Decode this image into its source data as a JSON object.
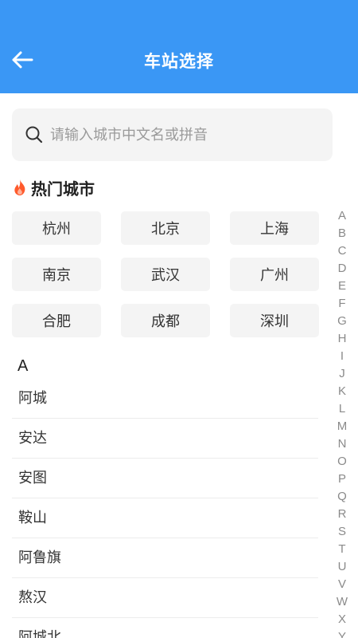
{
  "header": {
    "title": "车站选择",
    "back_icon": "arrow-left-icon"
  },
  "search": {
    "placeholder": "请输入城市中文名或拼音",
    "value": "",
    "icon": "search-icon"
  },
  "hot": {
    "title": "热门城市",
    "icon": "fire-icon",
    "icon_color": "#ff5a2c",
    "cities": [
      "杭州",
      "北京",
      "上海",
      "南京",
      "武汉",
      "广州",
      "合肥",
      "成都",
      "深圳"
    ]
  },
  "list": {
    "section": "A",
    "cities": [
      "阿城",
      "安达",
      "安图",
      "鞍山",
      "阿鲁旗",
      "熬汉",
      "阿城北"
    ]
  },
  "index_letters": [
    "A",
    "B",
    "C",
    "D",
    "E",
    "F",
    "G",
    "H",
    "I",
    "J",
    "K",
    "L",
    "M",
    "N",
    "O",
    "P",
    "Q",
    "R",
    "S",
    "T",
    "U",
    "V",
    "W",
    "X",
    "Y"
  ],
  "colors": {
    "header": "#3a97f5",
    "button_bg": "#f4f4f4"
  }
}
